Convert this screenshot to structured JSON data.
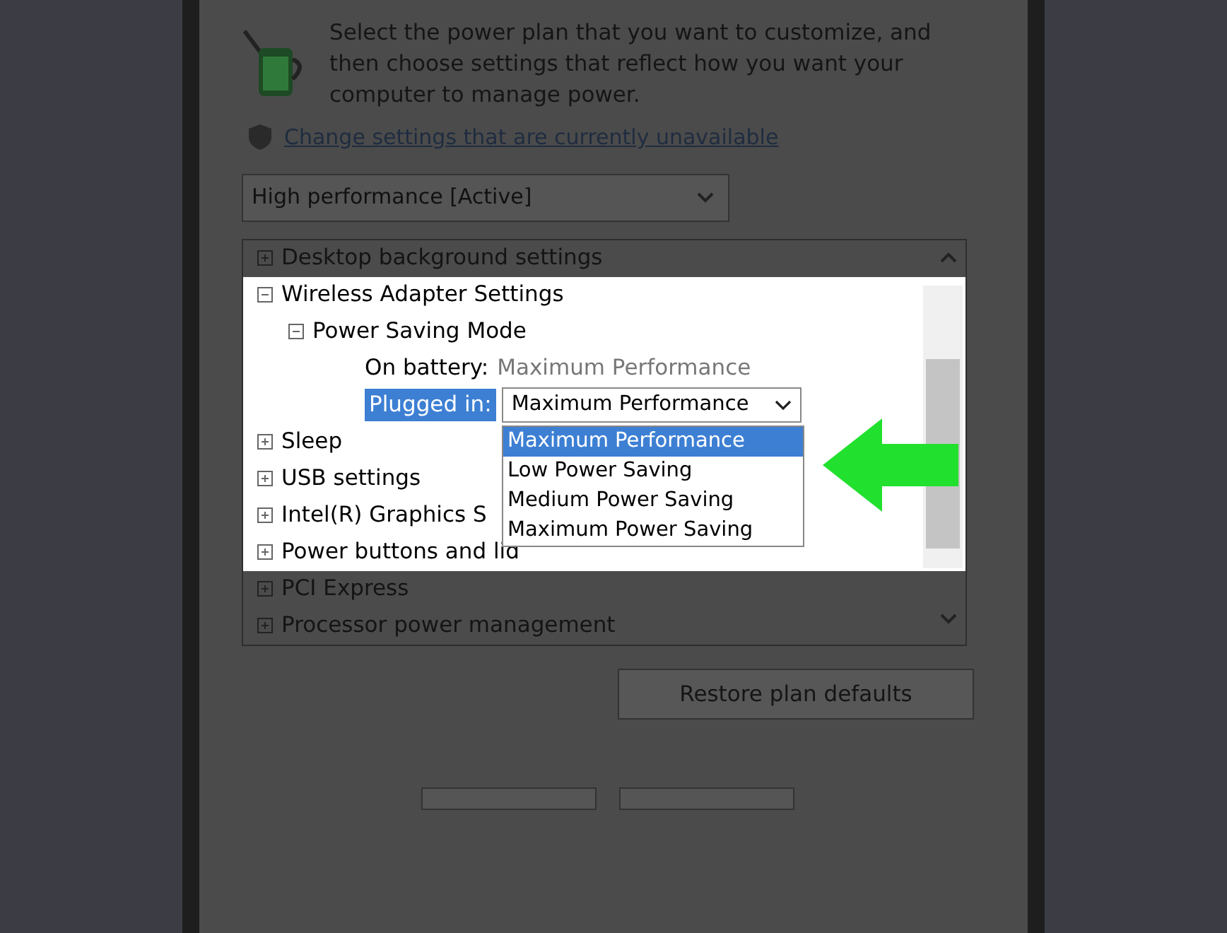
{
  "header": {
    "description": "Select the power plan that you want to customize, and then choose settings that reflect how you want your computer to manage power.",
    "link": "Change settings that are currently unavailable"
  },
  "plan_select": {
    "value": "High performance [Active]"
  },
  "settings_tree": [
    {
      "kind": "group",
      "label": "Desktop background settings",
      "expanded": false,
      "dimmed": true
    },
    {
      "kind": "group",
      "label": "Wireless Adapter Settings",
      "expanded": true,
      "dimmed": false,
      "children": [
        {
          "kind": "group",
          "label": "Power Saving Mode",
          "expanded": true,
          "dimmed": false,
          "children": [
            {
              "kind": "setting",
              "label": "On battery:",
              "value": "Maximum Performance",
              "selected": false,
              "dimmed": false
            },
            {
              "kind": "dropdown",
              "label": "Plugged in:",
              "value": "Maximum Performance",
              "selected": true,
              "dimmed": false,
              "open": true,
              "options": [
                {
                  "label": "Maximum Performance",
                  "selected": true
                },
                {
                  "label": "Low Power Saving",
                  "selected": false
                },
                {
                  "label": "Medium Power Saving",
                  "selected": false
                },
                {
                  "label": "Maximum Power Saving",
                  "selected": false
                }
              ]
            }
          ]
        }
      ]
    },
    {
      "kind": "group",
      "label": "Sleep",
      "expanded": false,
      "dimmed": false
    },
    {
      "kind": "group",
      "label": "USB settings",
      "expanded": false,
      "dimmed": false
    },
    {
      "kind": "group",
      "label": "Intel(R) Graphics S",
      "expanded": false,
      "dimmed": false
    },
    {
      "kind": "group",
      "label": "Power buttons and lid",
      "expanded": false,
      "dimmed": false
    },
    {
      "kind": "group",
      "label": "PCI Express",
      "expanded": false,
      "dimmed": true
    },
    {
      "kind": "group",
      "label": "Processor power management",
      "expanded": false,
      "dimmed": true
    }
  ],
  "buttons": [
    "Restore plan defaults"
  ]
}
